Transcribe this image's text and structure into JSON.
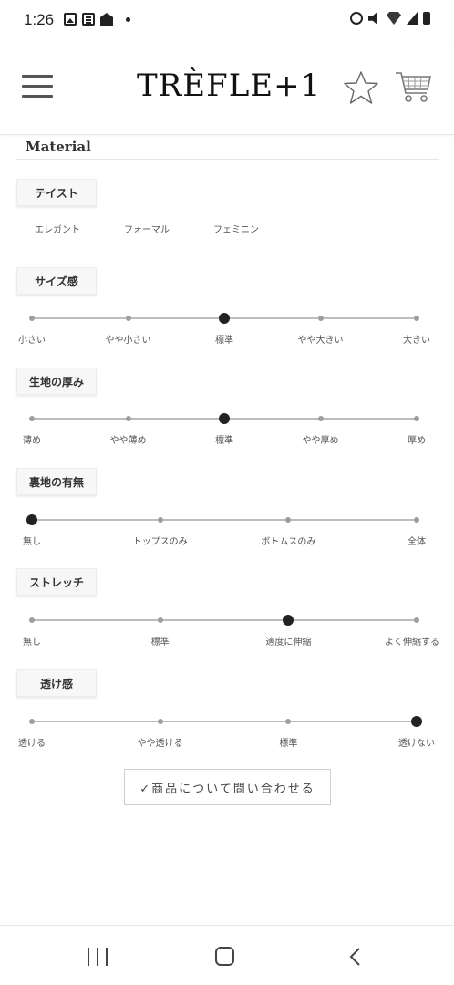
{
  "status_bar": {
    "time": "1:26"
  },
  "header": {
    "brand": "TRÈFLE+1"
  },
  "material": {
    "title": "Material",
    "taste": {
      "label": "テイスト",
      "options": [
        "エレガント",
        "フォーマル",
        "フェミニン"
      ]
    },
    "scales": [
      {
        "id": "size",
        "label": "サイズ感",
        "options": [
          "小さい",
          "やや小さい",
          "標準",
          "やや大きい",
          "大きい"
        ],
        "selected": 2
      },
      {
        "id": "thickness",
        "label": "生地の厚み",
        "options": [
          "薄め",
          "やや薄め",
          "標準",
          "やや厚め",
          "厚め"
        ],
        "selected": 2
      },
      {
        "id": "lining",
        "label": "裏地の有無",
        "options": [
          "無し",
          "トップスのみ",
          "ボトムスのみ",
          "全体"
        ],
        "selected": 0
      },
      {
        "id": "stretch",
        "label": "ストレッチ",
        "options": [
          "無し",
          "標準",
          "適度に伸縮",
          "よく伸縮する"
        ],
        "selected": 2
      },
      {
        "id": "sheer",
        "label": "透け感",
        "options": [
          "透ける",
          "やや透ける",
          "標準",
          "透けない"
        ],
        "selected": 3
      }
    ]
  },
  "inquiry_button": {
    "label": "✓商品について問い合わせる"
  },
  "icons": {
    "menu": "hamburger-icon",
    "favorite": "star-icon",
    "cart": "cart-icon",
    "nav_recents": "recents-icon",
    "nav_home": "home-icon",
    "nav_back": "back-icon"
  },
  "colors": {
    "selected_dot": "#222222",
    "dot": "#9e9e9e",
    "line": "#bdbdbd",
    "tag_bg": "#f7f7f7"
  }
}
